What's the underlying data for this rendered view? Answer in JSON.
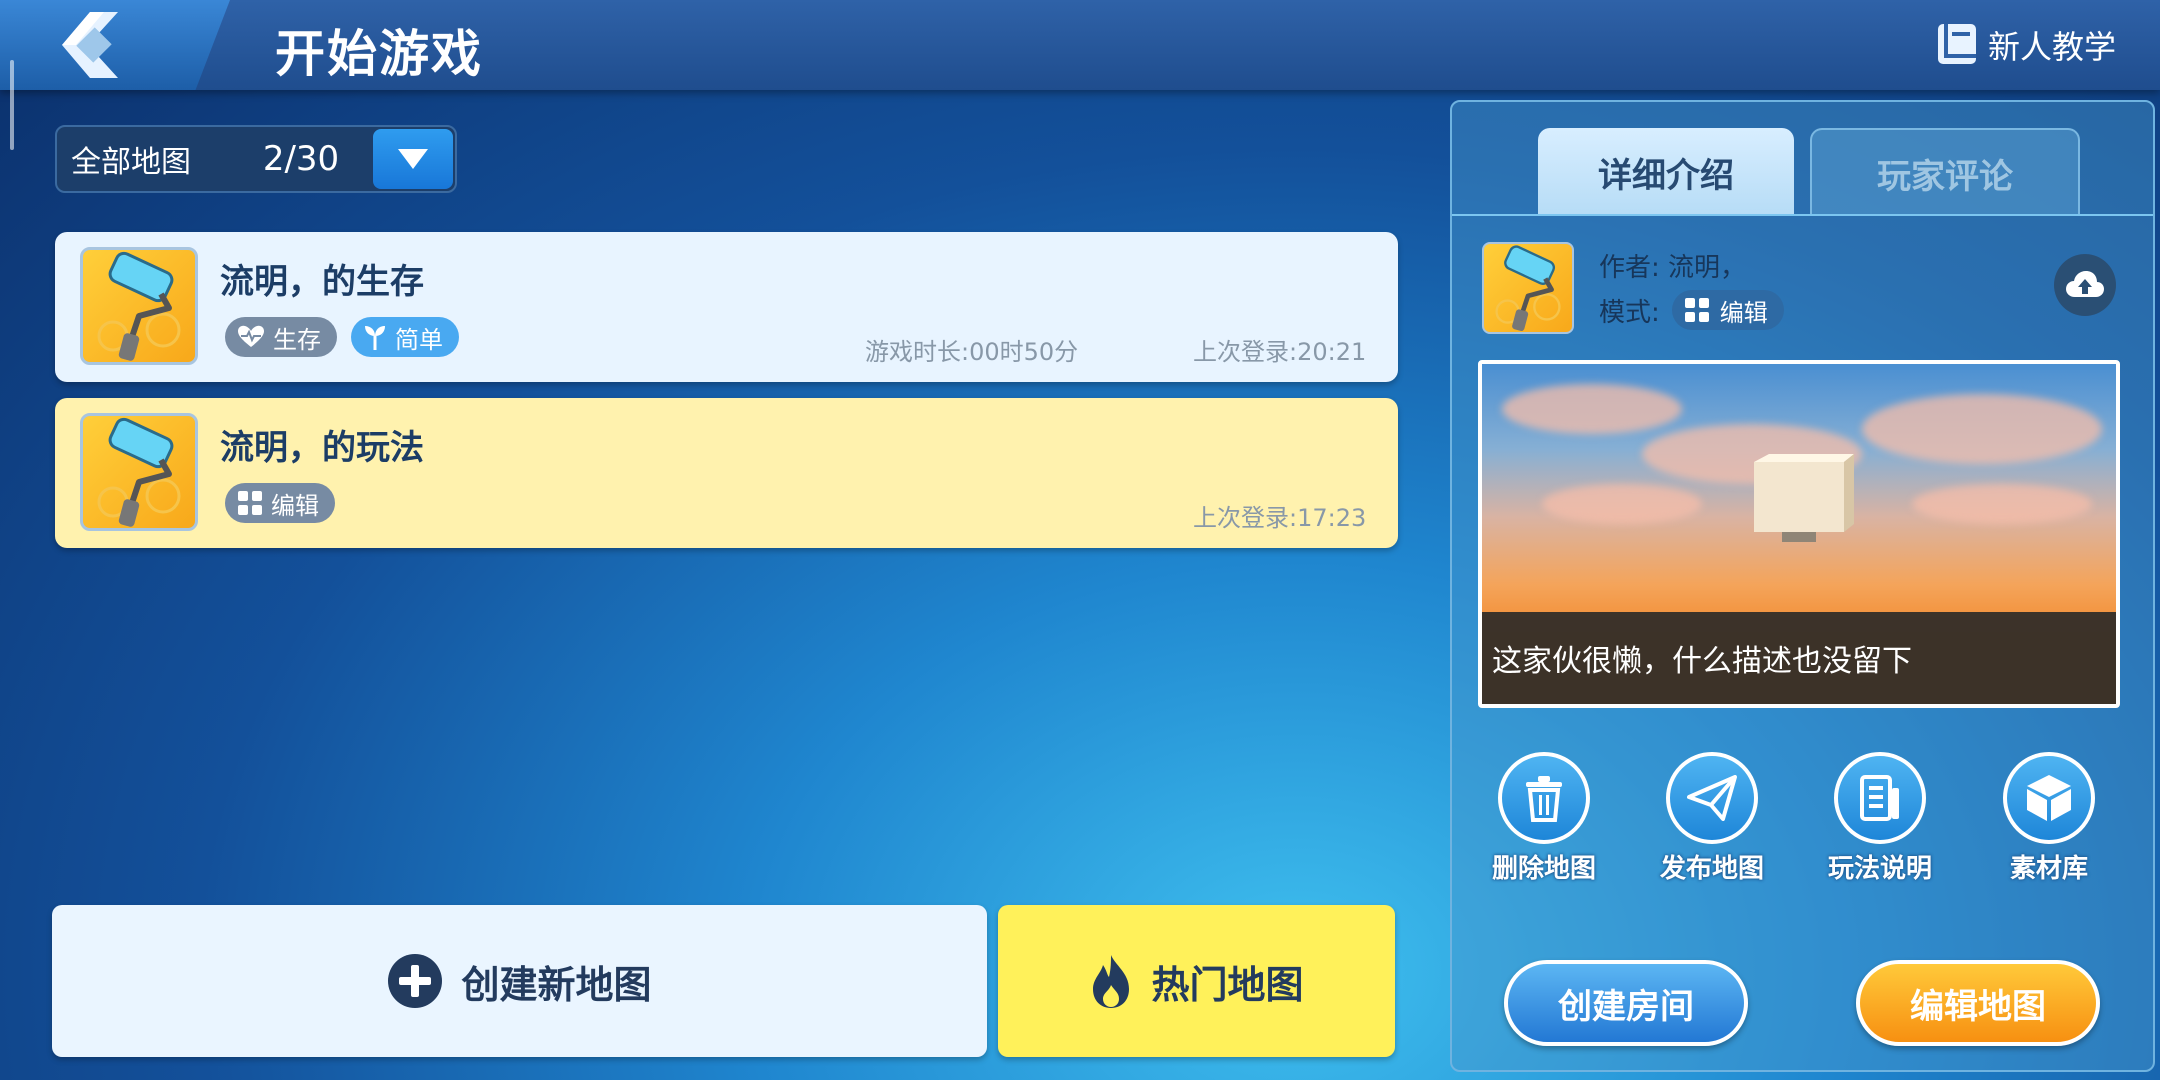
{
  "header": {
    "title": "开始游戏",
    "tutorial_label": "新人教学"
  },
  "filter": {
    "label": "全部地图",
    "count": "2/30"
  },
  "maps": [
    {
      "title": "流明，的生存",
      "tags": [
        {
          "label": "生存",
          "icon": "heart-pulse-icon"
        },
        {
          "label": "简单",
          "icon": "sprout-icon"
        }
      ],
      "playtime": "游戏时长:00时50分",
      "last_login": "上次登录:20:21"
    },
    {
      "title": "流明，的玩法",
      "tags": [
        {
          "label": "编辑",
          "icon": "grid-icon"
        }
      ],
      "last_login": "上次登录:17:23"
    }
  ],
  "buttons": {
    "create_map": "创建新地图",
    "hot_maps": "热门地图"
  },
  "detail": {
    "tabs": [
      "详细介绍",
      "玩家评论"
    ],
    "author": "作者:  流明，",
    "mode_label": "模式:",
    "mode_value": "编辑",
    "description": "这家伙很懒，什么描述也没留下",
    "actions": [
      "删除地图",
      "发布地图",
      "玩法说明",
      "素材库"
    ],
    "create_room": "创建房间",
    "edit_map": "编辑地图"
  },
  "colors": {
    "accent_blue": "#2378d4",
    "accent_orange": "#f79011",
    "hot_yellow": "#fff15a",
    "selected_row": "#fff2ae"
  }
}
